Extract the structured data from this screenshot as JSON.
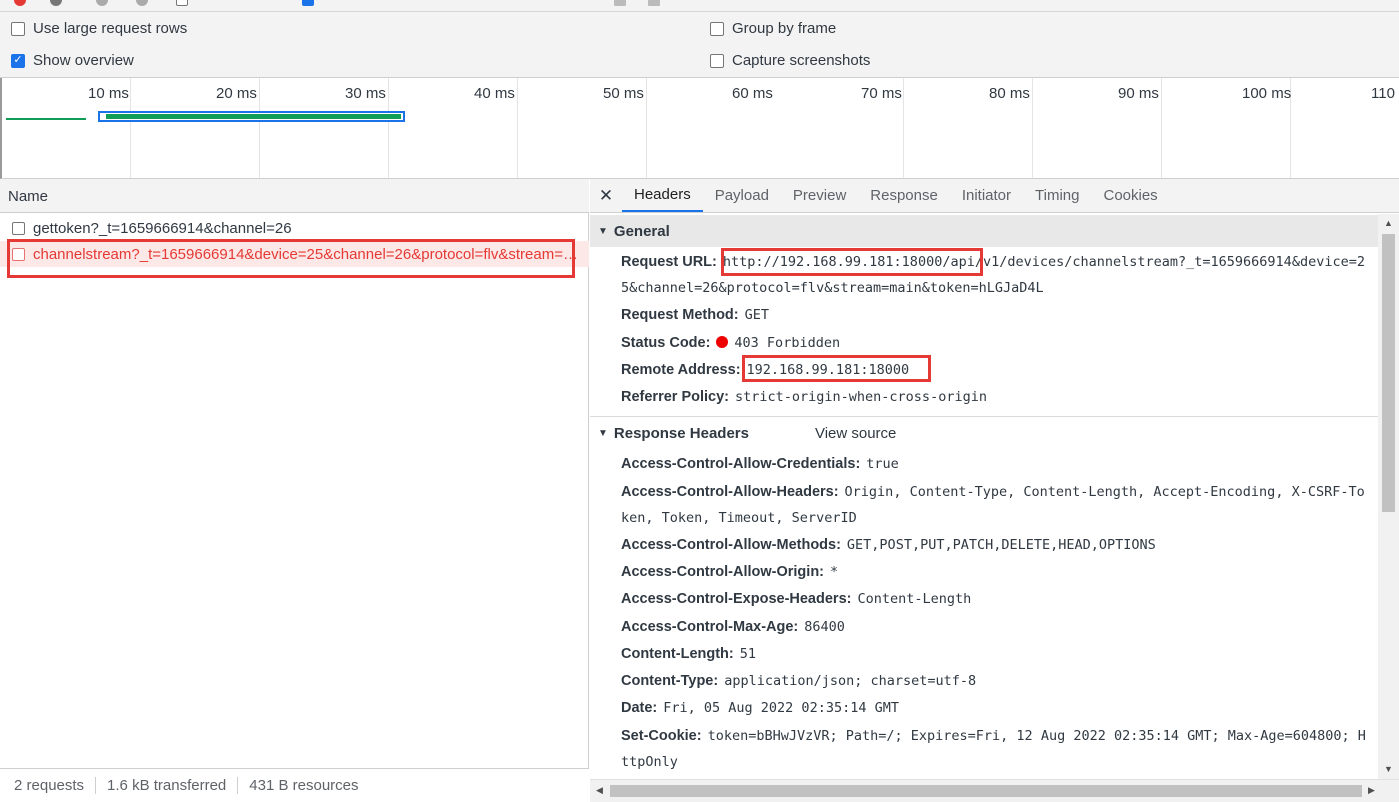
{
  "settings": {
    "large_rows": {
      "label": "Use large request rows",
      "checked": false
    },
    "show_overview": {
      "label": "Show overview",
      "checked": true
    },
    "group_by_frame": {
      "label": "Group by frame",
      "checked": false
    },
    "capture_screenshots": {
      "label": "Capture screenshots",
      "checked": false
    }
  },
  "overview": {
    "ticks": [
      "10 ms",
      "20 ms",
      "30 ms",
      "40 ms",
      "50 ms",
      "60 ms",
      "70 ms",
      "80 ms",
      "90 ms",
      "100 ms",
      "110"
    ]
  },
  "request_list": {
    "column_header": "Name",
    "rows": [
      {
        "name": "gettoken?_t=1659666914&channel=26",
        "error": false
      },
      {
        "name": "channelstream?_t=1659666914&device=25&channel=26&protocol=flv&stream=main&token=hLGJaD4L",
        "error": true
      }
    ]
  },
  "status_bar": {
    "requests": "2 requests",
    "transferred": "1.6 kB transferred",
    "resources": "431 B resources"
  },
  "detail_tabs": [
    "Headers",
    "Payload",
    "Preview",
    "Response",
    "Initiator",
    "Timing",
    "Cookies"
  ],
  "general": {
    "title": "General",
    "request_url_label": "Request URL:",
    "request_url_line1": "http://192.168.99.181:18000/api/v1/devices/channelstream?_t=1659666914&device=2",
    "request_url_line2": "5&channel=26&protocol=flv&stream=main&token=hLGJaD4L",
    "request_method_label": "Request Method:",
    "request_method": "GET",
    "status_code_label": "Status Code:",
    "status_code": "403 Forbidden",
    "remote_address_label": "Remote Address:",
    "remote_address": "192.168.99.181:18000",
    "referrer_policy_label": "Referrer Policy:",
    "referrer_policy": "strict-origin-when-cross-origin"
  },
  "response_headers": {
    "title": "Response Headers",
    "view_source": "View source",
    "items": [
      {
        "key": "Access-Control-Allow-Credentials:",
        "value": "true"
      },
      {
        "key": "Access-Control-Allow-Headers:",
        "value": "Origin, Content-Type, Content-Length, Accept-Encoding, X-CSRF-To",
        "cont": "ken, Token, Timeout, ServerID"
      },
      {
        "key": "Access-Control-Allow-Methods:",
        "value": "GET,POST,PUT,PATCH,DELETE,HEAD,OPTIONS"
      },
      {
        "key": "Access-Control-Allow-Origin:",
        "value": "*"
      },
      {
        "key": "Access-Control-Expose-Headers:",
        "value": "Content-Length"
      },
      {
        "key": "Access-Control-Max-Age:",
        "value": "86400"
      },
      {
        "key": "Content-Length:",
        "value": "51"
      },
      {
        "key": "Content-Type:",
        "value": "application/json; charset=utf-8"
      },
      {
        "key": "Date:",
        "value": "Fri, 05 Aug 2022 02:35:14 GMT"
      },
      {
        "key": "Set-Cookie:",
        "value": "token=bBHwJVzVR; Path=/; Expires=Fri, 12 Aug 2022 02:35:14 GMT; Max-Age=604800; H",
        "cont": "ttpOnly"
      }
    ]
  },
  "colors": {
    "accent": "#1a73e8",
    "error": "#e53935",
    "timeline_bar": "#0f9d58"
  }
}
